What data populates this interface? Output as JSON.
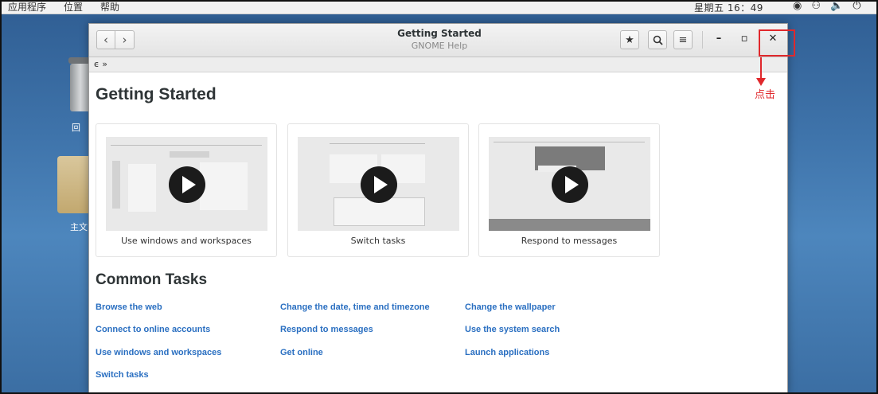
{
  "top_panel": {
    "menus": [
      "应用程序",
      "位置",
      "帮助"
    ],
    "clock": "星期五 16：49"
  },
  "desktop": {
    "trash_label": "回",
    "home_label": "主文"
  },
  "window": {
    "title": "Getting Started",
    "subtitle": "GNOME Help",
    "pathbar": "ϵ »"
  },
  "page": {
    "title": "Getting Started",
    "videos": [
      {
        "caption": "Use windows and workspaces"
      },
      {
        "caption": "Switch tasks"
      },
      {
        "caption": "Respond to messages"
      }
    ],
    "common_tasks_title": "Common Tasks",
    "tasks": {
      "col1": [
        "Browse the web",
        "Connect to online accounts",
        "Use windows and workspaces",
        "Switch tasks"
      ],
      "col2": [
        "Change the date, time and timezone",
        "Respond to messages",
        "Get online"
      ],
      "col3": [
        "Change the wallpaper",
        "Use the system search",
        "Launch applications"
      ]
    }
  },
  "annotation": {
    "label": "点击",
    "color": "#e0282c"
  },
  "colors": {
    "link": "#2a6fc1",
    "heading": "#2e3436"
  }
}
